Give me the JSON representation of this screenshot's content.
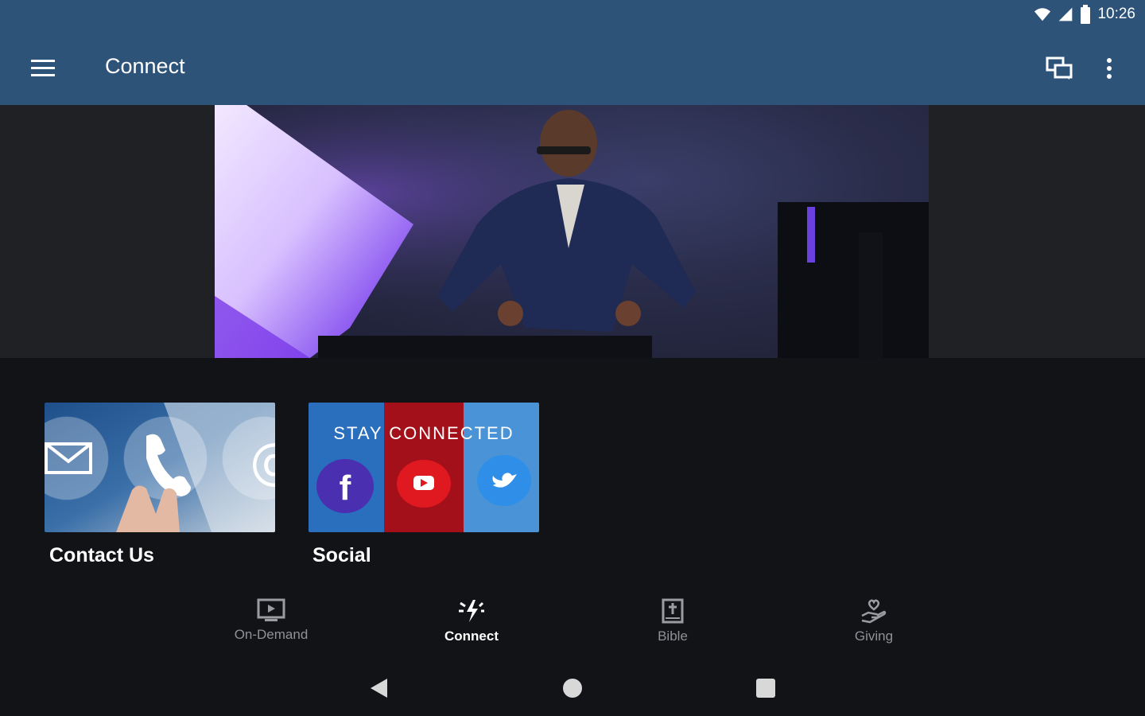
{
  "status_bar": {
    "time": "10:26",
    "icons": [
      "wifi-icon",
      "signal-icon",
      "battery-icon"
    ]
  },
  "app_bar": {
    "title": "Connect",
    "menu_icon": "hamburger-menu-icon",
    "chat_icon": "chat-icon",
    "more_icon": "more-vert-icon",
    "color": "#2e5379"
  },
  "cards": [
    {
      "label": "Contact Us"
    },
    {
      "label": "Social",
      "banner_text": "STAY CONNECTED"
    }
  ],
  "bottom_nav": [
    {
      "label": "On-Demand",
      "icon": "tv-play-icon",
      "active": false
    },
    {
      "label": "Connect",
      "icon": "connect-spark-icon",
      "active": true
    },
    {
      "label": "Bible",
      "icon": "bible-icon",
      "active": false
    },
    {
      "label": "Giving",
      "icon": "giving-hand-icon",
      "active": false
    }
  ],
  "system_nav": [
    "back-icon",
    "home-icon",
    "recents-icon"
  ]
}
